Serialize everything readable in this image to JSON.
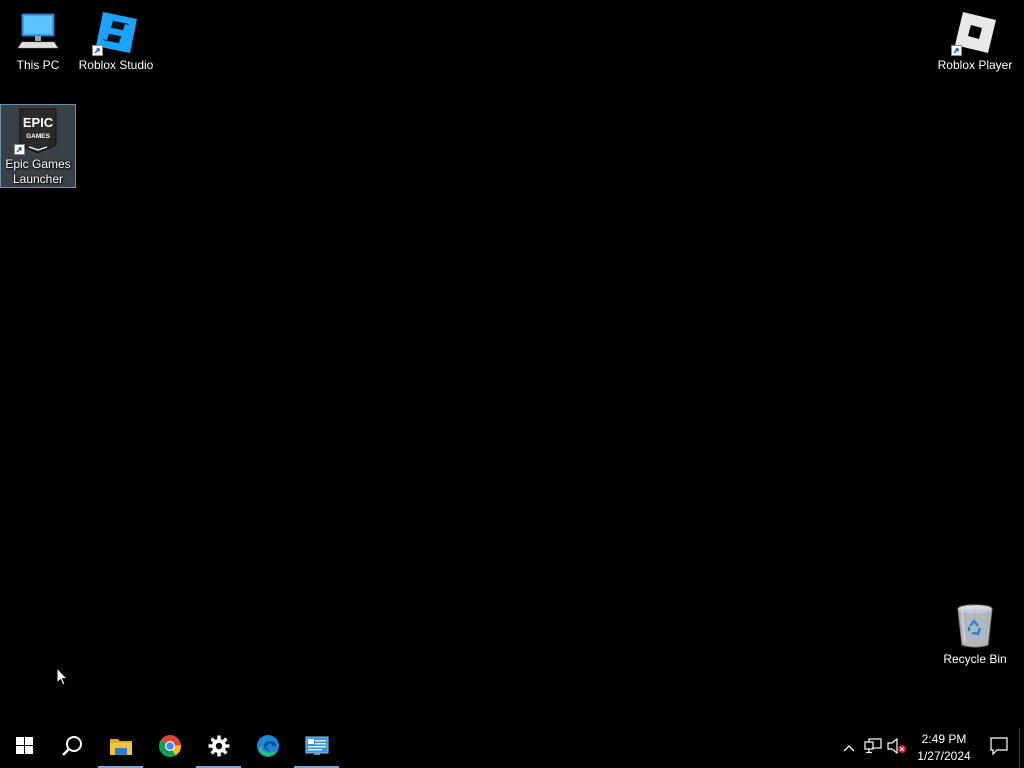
{
  "desktop": {
    "icons": [
      {
        "label": "This PC",
        "icon": "this-pc-icon",
        "shortcut": false
      },
      {
        "label": "Roblox Studio",
        "icon": "roblox-studio-icon",
        "shortcut": true
      },
      {
        "label": "Epic Games Launcher",
        "icon": "epic-games-icon",
        "shortcut": true,
        "selected": true,
        "logo_text": [
          "EPIC",
          "GAMES"
        ]
      },
      {
        "label": "Roblox Player",
        "icon": "roblox-player-icon",
        "shortcut": true
      },
      {
        "label": "Recycle Bin",
        "icon": "recycle-bin-icon",
        "shortcut": false
      }
    ]
  },
  "taskbar": {
    "start": {
      "icon": "windows-start-icon"
    },
    "search": {
      "icon": "search-icon"
    },
    "apps": [
      {
        "name": "File Explorer",
        "icon": "file-explorer-icon",
        "running": true
      },
      {
        "name": "Google Chrome",
        "icon": "chrome-icon",
        "running": false
      },
      {
        "name": "Settings",
        "icon": "gear-icon",
        "running": true
      },
      {
        "name": "Microsoft Edge",
        "icon": "edge-icon",
        "running": false
      },
      {
        "name": "Control Panel",
        "icon": "control-panel-icon",
        "running": true
      }
    ],
    "tray": {
      "icons": [
        "chevron-up-icon",
        "network-icon",
        "volume-muted-icon"
      ],
      "time": "2:49 PM",
      "date": "1/27/2024",
      "notification_icon": "action-center-icon"
    }
  },
  "colors": {
    "desktop_bg": "#000000",
    "taskbar_bg": "#000000",
    "running_indicator": "#7aa6d6",
    "selection": "#cce8ff"
  }
}
